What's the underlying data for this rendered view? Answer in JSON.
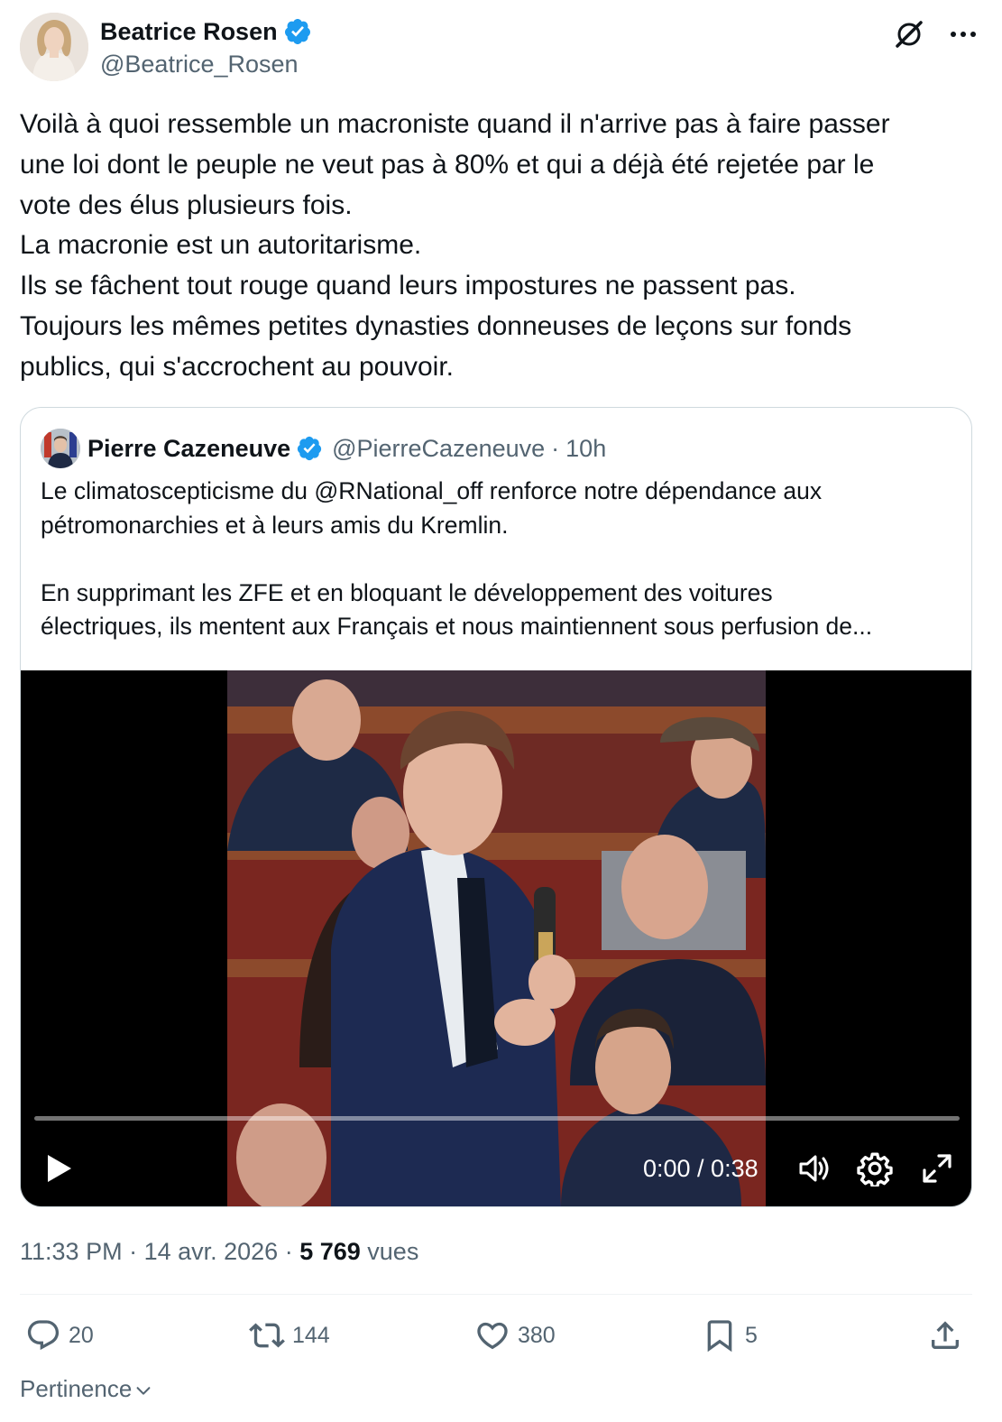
{
  "author": {
    "name": "Beatrice Rosen",
    "handle": "@Beatrice_Rosen",
    "verified": true,
    "avatar_icon": "profile-photo"
  },
  "tweet": {
    "lines": [
      "Voilà à quoi ressemble un macroniste quand il n'arrive pas à faire passer",
      "une loi dont le peuple ne veut pas à 80% et qui a déjà été rejetée par le",
      "vote des élus plusieurs fois.",
      "La macronie est un autoritarisme.",
      "Ils se fâchent tout rouge quand leurs impostures ne passent pas.",
      "Toujours les mêmes petites dynasties donneuses de leçons sur fonds",
      "publics, qui s'accrochent au pouvoir."
    ]
  },
  "quote": {
    "name": "Pierre Cazeneuve",
    "handle": "@PierreCazeneuve",
    "dot": "·",
    "time": "10h",
    "lines": [
      "Le climatoscepticisme du @RNational_off renforce notre dépendance aux",
      "pétromonarchies et à leurs amis du Kremlin.",
      "",
      "En supprimant les ZFE et en bloquant le développement des voitures",
      "électriques, ils mentent aux Français et nous maintiennent sous perfusion de..."
    ],
    "video": {
      "time_display": "0:00 / 0:38",
      "progress": 0
    }
  },
  "meta": {
    "time": "11:33 PM",
    "sep1": " · ",
    "date": "14 avr. 2026",
    "sep2": " · ",
    "views_count": "5 769",
    "views_label": " vues"
  },
  "actions": {
    "replies": "20",
    "reposts": "144",
    "likes": "380",
    "bookmarks": "5"
  },
  "sort": {
    "label": "Pertinence"
  },
  "colors": {
    "verified": "#1d9bf0",
    "secondary_text": "#536471",
    "primary_text": "#0f1419",
    "border": "#cfd9de"
  }
}
